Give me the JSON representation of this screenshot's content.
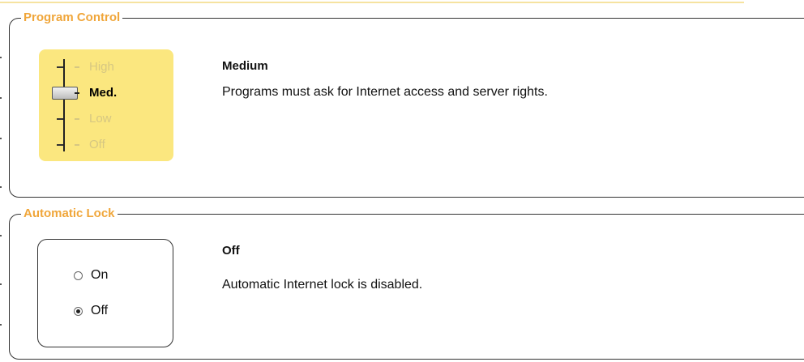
{
  "program_control": {
    "legend": "Program Control",
    "levels": [
      "High",
      "Med.",
      "Low",
      "Off"
    ],
    "selected_level": "Med.",
    "title": "Medium",
    "description": "Programs must ask for Internet access and server rights."
  },
  "automatic_lock": {
    "legend": "Automatic Lock",
    "options": [
      "On",
      "Off"
    ],
    "selected": "Off",
    "title": "Off",
    "description": "Automatic Internet lock is disabled."
  },
  "colors": {
    "legend": "#f0a63a",
    "slider_bg": "#fbe77f",
    "inactive_level": "#d6c782"
  }
}
